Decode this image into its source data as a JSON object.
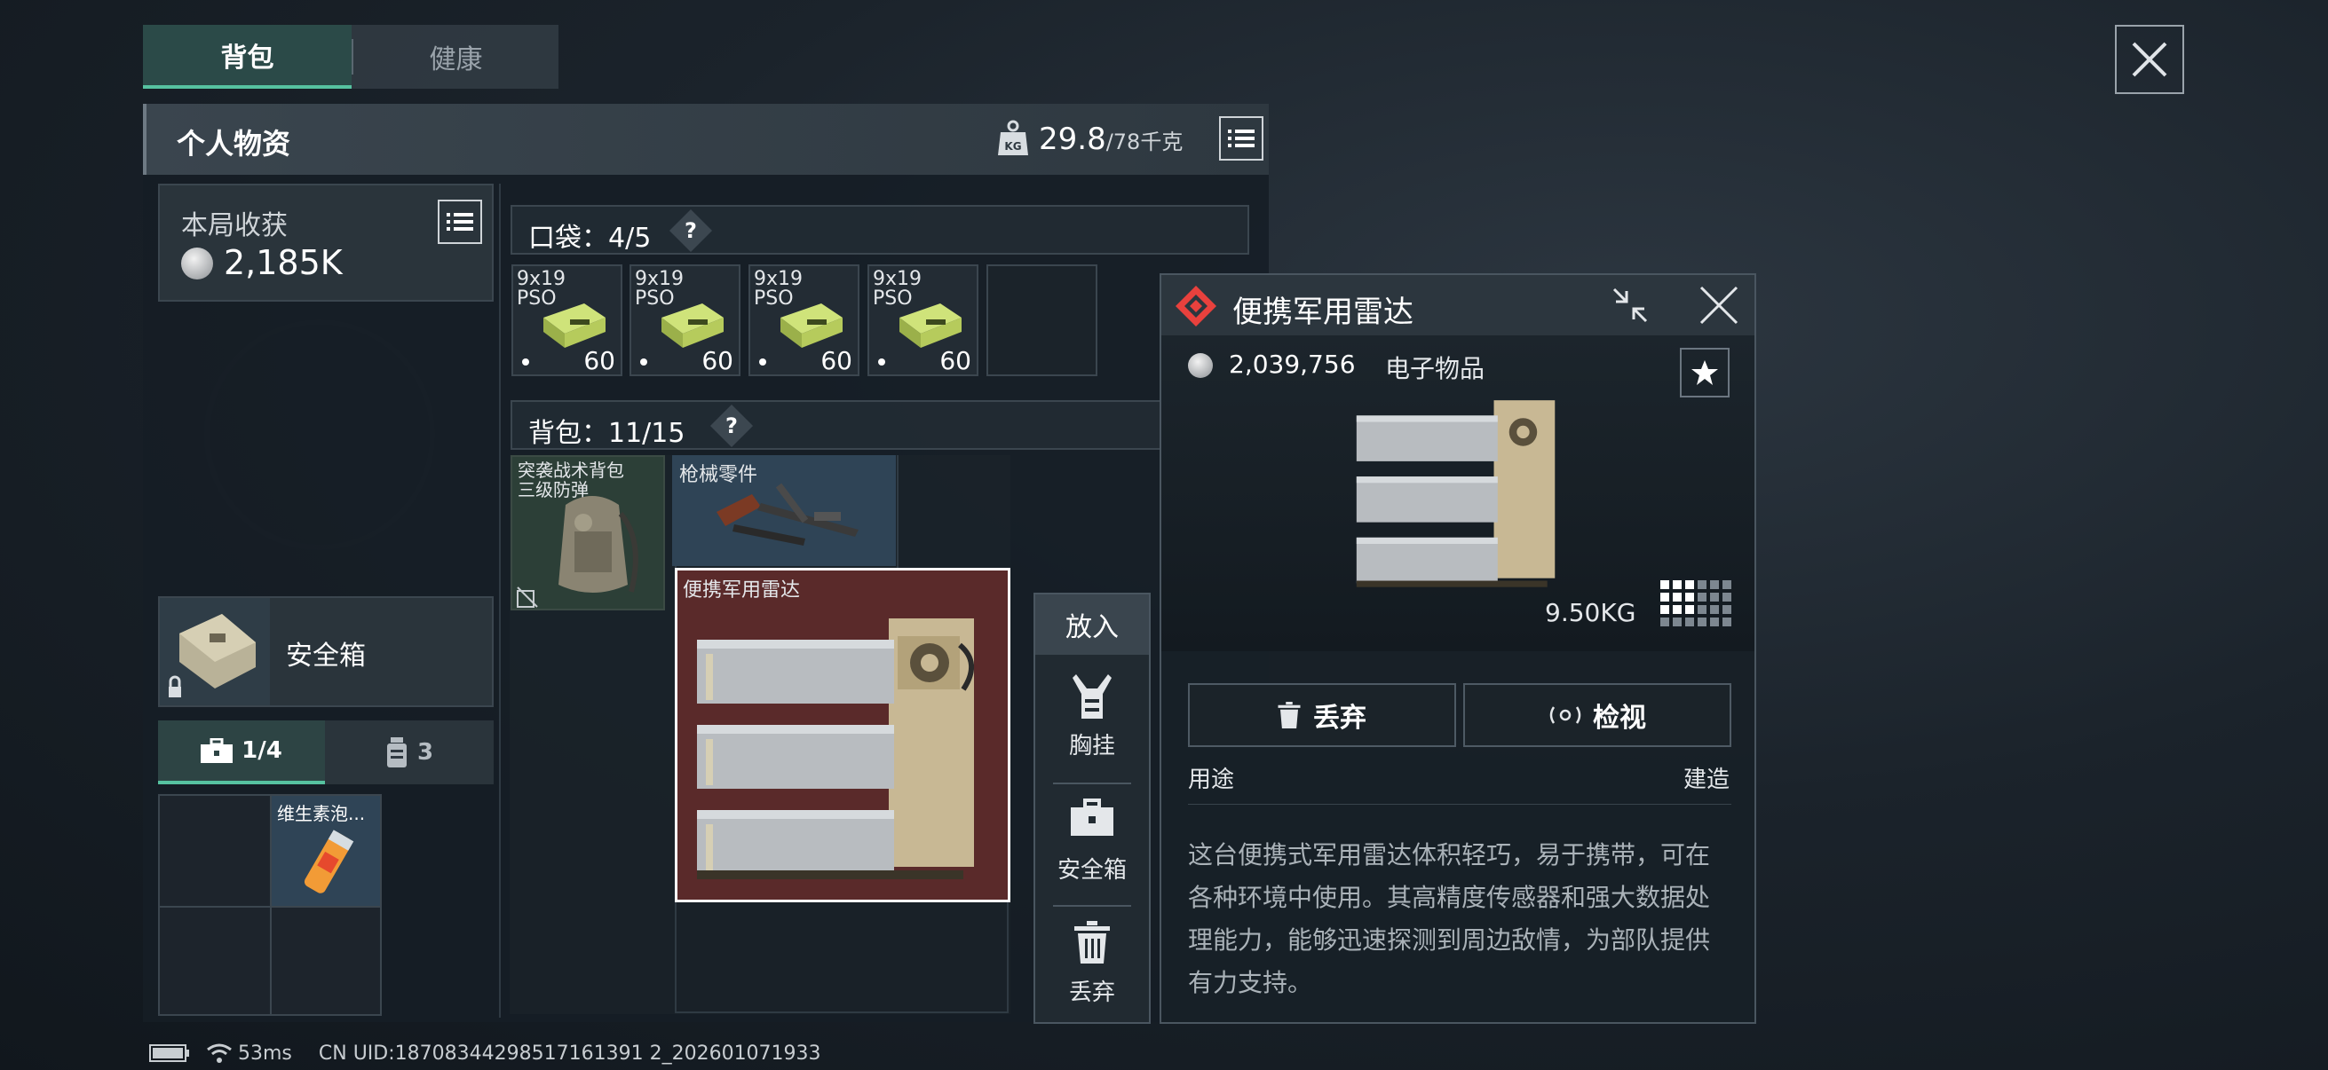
{
  "tabs": [
    {
      "label": "背包",
      "active": true
    },
    {
      "label": "健康",
      "active": false
    }
  ],
  "header": {
    "title": "个人物资",
    "weight_current": "29.8",
    "weight_max": "/78千克"
  },
  "earnings": {
    "label": "本局收获",
    "value": "2,185K"
  },
  "safe_box": {
    "label": "安全箱"
  },
  "sub_tabs": [
    {
      "label": "1/4",
      "icon": "toolbox-icon",
      "active": true
    },
    {
      "label": "3",
      "icon": "bottle-icon",
      "active": false
    }
  ],
  "sub_items": [
    {
      "name": "维生素泡..."
    }
  ],
  "pocket": {
    "label": "口袋：4/5",
    "help": "?",
    "items": [
      {
        "name": "9x19\nPSO",
        "count": "60"
      },
      {
        "name": "9x19\nPSO",
        "count": "60"
      },
      {
        "name": "9x19\nPSO",
        "count": "60"
      },
      {
        "name": "9x19\nPSO",
        "count": "60"
      }
    ]
  },
  "backpack": {
    "label": "背包：11/15",
    "help": "?",
    "items": [
      {
        "name": "突袭战术背包\n三级防弹"
      },
      {
        "name": "枪械零件"
      },
      {
        "name": "便携军用雷达"
      }
    ]
  },
  "action_menu": {
    "title": "放入",
    "items": [
      {
        "label": "胸挂",
        "icon": "chest-rig-icon"
      },
      {
        "label": "安全箱",
        "icon": "safe-box-icon"
      },
      {
        "label": "丢弃",
        "icon": "trash-icon"
      }
    ]
  },
  "detail": {
    "title": "便携军用雷达",
    "price": "2,039,756",
    "category": "电子物品",
    "weight": "9.50KG",
    "discard_label": "丢弃",
    "inspect_label": "检视",
    "use_label": "用途",
    "build_label": "建造",
    "description": "这台便携式军用雷达体积轻巧，易于携带，可在各种环境中使用。其高精度传感器和强大数据处理能力，能够迅速探测到周边敌情，为部队提供有力支持。"
  },
  "status": {
    "ping": "53ms",
    "uid": "CN UID:18708344298517161391 2_202601071933"
  },
  "colors": {
    "accent_green": "#56c2a0",
    "rarity_red": "#e8413d",
    "selected_item_bg": "#5a2a2a"
  }
}
